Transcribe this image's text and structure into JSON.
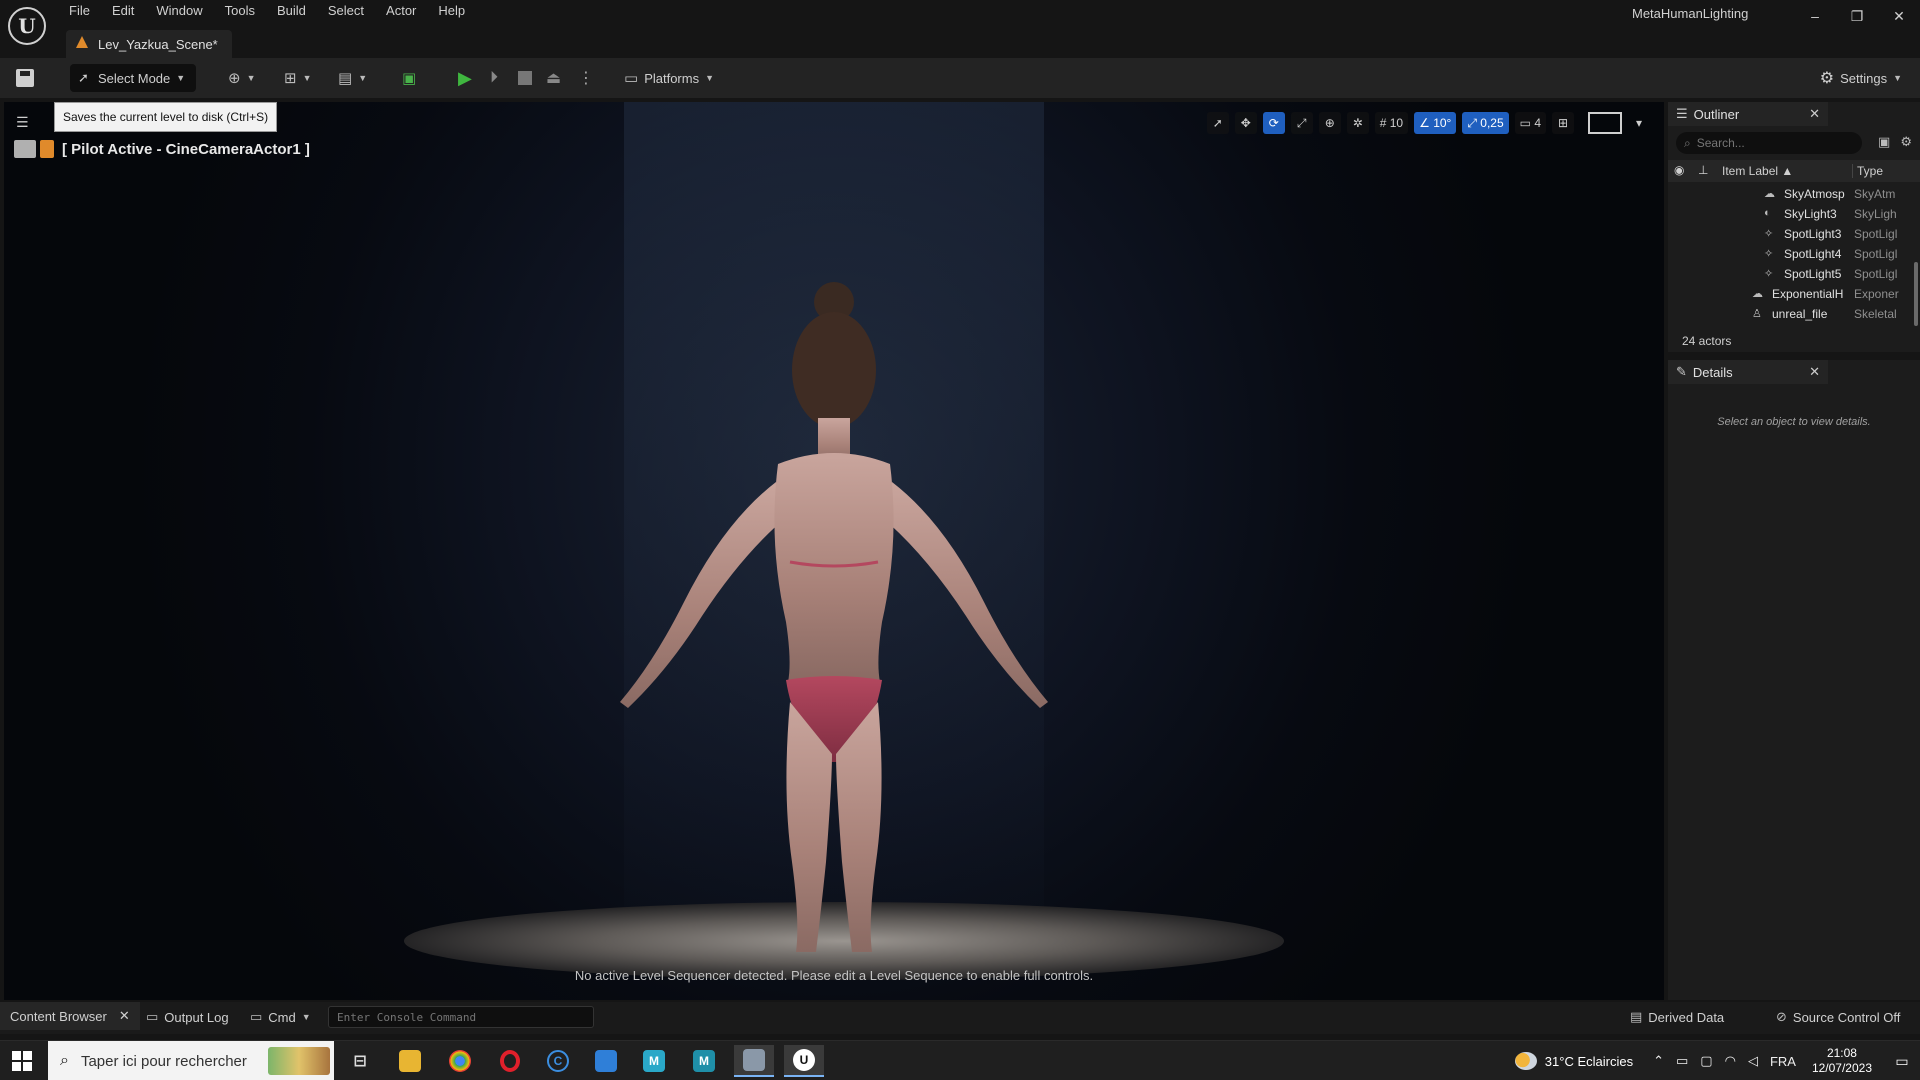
{
  "app": {
    "title": "MetaHumanLighting",
    "logo": "U",
    "document_tab": "Lev_Yazkua_Scene*"
  },
  "menu": [
    "File",
    "Edit",
    "Window",
    "Tools",
    "Build",
    "Select",
    "Actor",
    "Help"
  ],
  "window_controls": {
    "minimize": "–",
    "restore": "❐",
    "close": "✕"
  },
  "toolbar": {
    "select_mode": "Select Mode",
    "platforms": "Platforms",
    "settings": "Settings"
  },
  "tooltip": {
    "text": "Saves the current level to disk (Ctrl+S)"
  },
  "viewport": {
    "pilot_label": "[ Pilot Active - CineCameraActor1 ]",
    "grid_snap": "10",
    "rotation_snap": "10°",
    "scale_snap": "0,25",
    "camera_speed": "4",
    "sequencer_message": "No active Level Sequencer detected. Please edit a Level Sequence to enable full controls."
  },
  "outliner": {
    "title": "Outliner",
    "search_placeholder": "Search...",
    "col_label": "Item Label ▲",
    "col_type": "Type",
    "rows": [
      {
        "name": "SkyAtmosp",
        "type": "SkyAtm",
        "icon": "sky-atmosphere-icon",
        "indent": 1
      },
      {
        "name": "SkyLight3",
        "type": "SkyLigh",
        "icon": "skylight-icon",
        "indent": 1
      },
      {
        "name": "SpotLight3",
        "type": "SpotLigl",
        "icon": "spotlight-icon",
        "indent": 1
      },
      {
        "name": "SpotLight4",
        "type": "SpotLigl",
        "icon": "spotlight-icon",
        "indent": 1
      },
      {
        "name": "SpotLight5",
        "type": "SpotLigl",
        "icon": "spotlight-icon",
        "indent": 1
      },
      {
        "name": "ExponentialH",
        "type": "Exponer",
        "icon": "fog-icon",
        "indent": 0
      },
      {
        "name": "unreal_file",
        "type": "Skeletal",
        "icon": "skeletal-mesh-icon",
        "indent": 0
      }
    ],
    "actor_count": "24 actors"
  },
  "details": {
    "title": "Details",
    "empty_message": "Select an object to view details."
  },
  "statusbar": {
    "content_browser": "Content Browser",
    "output_log": "Output Log",
    "cmd": "Cmd",
    "console_placeholder": "Enter Console Command",
    "derived_data": "Derived Data",
    "source_control": "Source Control Off"
  },
  "taskbar": {
    "search_placeholder": "Taper ici pour rechercher",
    "apps": [
      {
        "name": "task-view",
        "label": ""
      },
      {
        "name": "file-explorer",
        "label": ""
      },
      {
        "name": "chrome",
        "label": ""
      },
      {
        "name": "opera",
        "label": ""
      },
      {
        "name": "ccleaner",
        "label": "C"
      },
      {
        "name": "window-app",
        "label": ""
      },
      {
        "name": "maya",
        "label": "M"
      },
      {
        "name": "maya-lt",
        "label": "M"
      },
      {
        "name": "launcher",
        "label": ""
      },
      {
        "name": "unreal-engine",
        "label": "U"
      }
    ],
    "weather": "31°C  Eclaircies",
    "language": "FRA",
    "time": "21:08",
    "date": "12/07/2023"
  },
  "colors": {
    "accent": "#1f5fbf",
    "play_green": "#3fb63f",
    "level_orange": "#e08a2b",
    "panel_bg": "#1c1c1c"
  }
}
